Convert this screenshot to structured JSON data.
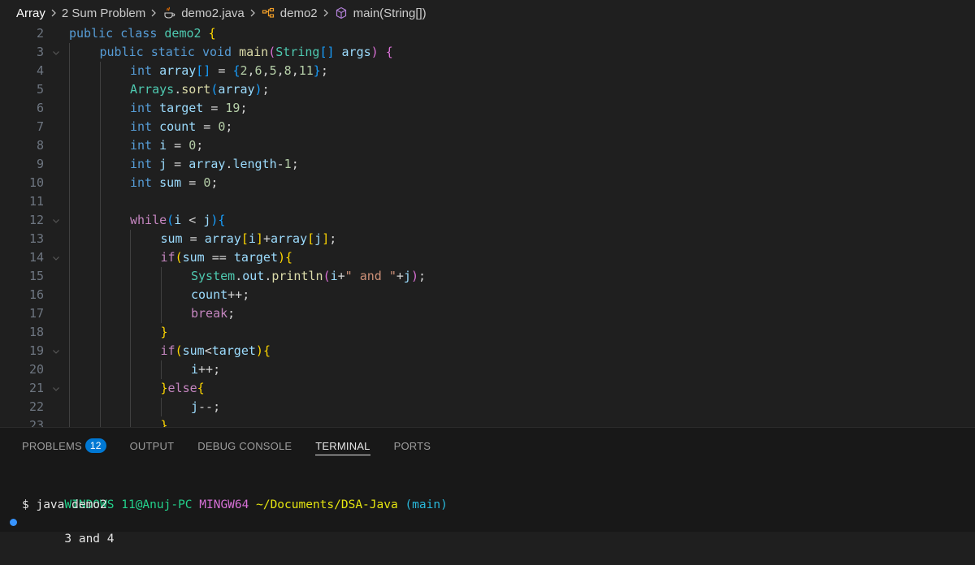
{
  "breadcrumb": {
    "items": [
      {
        "label": "Array",
        "icon": ""
      },
      {
        "label": "2 Sum Problem",
        "icon": ""
      },
      {
        "label": "demo2.java",
        "icon": "java-file-icon"
      },
      {
        "label": "demo2",
        "icon": "class-icon"
      },
      {
        "label": "main(String[])",
        "icon": "method-icon"
      }
    ]
  },
  "editor": {
    "lines": [
      {
        "num": "2",
        "fold": false,
        "indent": 0,
        "tokens": [
          [
            "kw",
            "public"
          ],
          [
            "p",
            " "
          ],
          [
            "kw",
            "class"
          ],
          [
            "p",
            " "
          ],
          [
            "type",
            "demo2"
          ],
          [
            "p",
            " "
          ],
          [
            "b1",
            "{"
          ]
        ]
      },
      {
        "num": "3",
        "fold": true,
        "indent": 1,
        "tokens": [
          [
            "kw",
            "public"
          ],
          [
            "p",
            " "
          ],
          [
            "kw",
            "static"
          ],
          [
            "p",
            " "
          ],
          [
            "kw",
            "void"
          ],
          [
            "p",
            " "
          ],
          [
            "fn",
            "main"
          ],
          [
            "b2",
            "("
          ],
          [
            "type",
            "String"
          ],
          [
            "b3",
            "[]"
          ],
          [
            "p",
            " "
          ],
          [
            "var",
            "args"
          ],
          [
            "b2",
            ")"
          ],
          [
            "p",
            " "
          ],
          [
            "b2",
            "{"
          ]
        ]
      },
      {
        "num": "4",
        "fold": false,
        "indent": 2,
        "tokens": [
          [
            "kw",
            "int"
          ],
          [
            "p",
            " "
          ],
          [
            "var",
            "array"
          ],
          [
            "b3",
            "[]"
          ],
          [
            "p",
            " = "
          ],
          [
            "b3",
            "{"
          ],
          [
            "num",
            "2"
          ],
          [
            "p",
            ","
          ],
          [
            "num",
            "6"
          ],
          [
            "p",
            ","
          ],
          [
            "num",
            "5"
          ],
          [
            "p",
            ","
          ],
          [
            "num",
            "8"
          ],
          [
            "p",
            ","
          ],
          [
            "num",
            "11"
          ],
          [
            "b3",
            "}"
          ],
          [
            "p",
            ";"
          ]
        ]
      },
      {
        "num": "5",
        "fold": false,
        "indent": 2,
        "tokens": [
          [
            "type",
            "Arrays"
          ],
          [
            "p",
            "."
          ],
          [
            "fn",
            "sort"
          ],
          [
            "b3",
            "("
          ],
          [
            "var",
            "array"
          ],
          [
            "b3",
            ")"
          ],
          [
            "p",
            ";"
          ]
        ]
      },
      {
        "num": "6",
        "fold": false,
        "indent": 2,
        "tokens": [
          [
            "kw",
            "int"
          ],
          [
            "p",
            " "
          ],
          [
            "var",
            "target"
          ],
          [
            "p",
            " = "
          ],
          [
            "num",
            "19"
          ],
          [
            "p",
            ";"
          ]
        ]
      },
      {
        "num": "7",
        "fold": false,
        "indent": 2,
        "tokens": [
          [
            "kw",
            "int"
          ],
          [
            "p",
            " "
          ],
          [
            "var",
            "count"
          ],
          [
            "p",
            " = "
          ],
          [
            "num",
            "0"
          ],
          [
            "p",
            ";"
          ]
        ]
      },
      {
        "num": "8",
        "fold": false,
        "indent": 2,
        "tokens": [
          [
            "kw",
            "int"
          ],
          [
            "p",
            " "
          ],
          [
            "var",
            "i"
          ],
          [
            "p",
            " = "
          ],
          [
            "num",
            "0"
          ],
          [
            "p",
            ";"
          ]
        ]
      },
      {
        "num": "9",
        "fold": false,
        "indent": 2,
        "tokens": [
          [
            "kw",
            "int"
          ],
          [
            "p",
            " "
          ],
          [
            "var",
            "j"
          ],
          [
            "p",
            " = "
          ],
          [
            "var",
            "array"
          ],
          [
            "p",
            "."
          ],
          [
            "var",
            "length"
          ],
          [
            "p",
            "-"
          ],
          [
            "num",
            "1"
          ],
          [
            "p",
            ";"
          ]
        ]
      },
      {
        "num": "10",
        "fold": false,
        "indent": 2,
        "tokens": [
          [
            "kw",
            "int"
          ],
          [
            "p",
            " "
          ],
          [
            "var",
            "sum"
          ],
          [
            "p",
            " = "
          ],
          [
            "num",
            "0"
          ],
          [
            "p",
            ";"
          ]
        ]
      },
      {
        "num": "11",
        "fold": false,
        "indent": 2,
        "tokens": []
      },
      {
        "num": "12",
        "fold": true,
        "indent": 2,
        "tokens": [
          [
            "ctrl",
            "while"
          ],
          [
            "b3",
            "("
          ],
          [
            "var",
            "i"
          ],
          [
            "p",
            " < "
          ],
          [
            "var",
            "j"
          ],
          [
            "b3",
            ")"
          ],
          [
            "b3",
            "{"
          ]
        ]
      },
      {
        "num": "13",
        "fold": false,
        "indent": 3,
        "tokens": [
          [
            "var",
            "sum"
          ],
          [
            "p",
            " = "
          ],
          [
            "var",
            "array"
          ],
          [
            "b1",
            "["
          ],
          [
            "var",
            "i"
          ],
          [
            "b1",
            "]"
          ],
          [
            "p",
            "+"
          ],
          [
            "var",
            "array"
          ],
          [
            "b1",
            "["
          ],
          [
            "var",
            "j"
          ],
          [
            "b1",
            "]"
          ],
          [
            "p",
            ";"
          ]
        ]
      },
      {
        "num": "14",
        "fold": true,
        "indent": 3,
        "tokens": [
          [
            "ctrl",
            "if"
          ],
          [
            "b1",
            "("
          ],
          [
            "var",
            "sum"
          ],
          [
            "p",
            " == "
          ],
          [
            "var",
            "target"
          ],
          [
            "b1",
            ")"
          ],
          [
            "b1",
            "{"
          ]
        ]
      },
      {
        "num": "15",
        "fold": false,
        "indent": 4,
        "tokens": [
          [
            "type",
            "System"
          ],
          [
            "p",
            "."
          ],
          [
            "var",
            "out"
          ],
          [
            "p",
            "."
          ],
          [
            "fn",
            "println"
          ],
          [
            "b2",
            "("
          ],
          [
            "var",
            "i"
          ],
          [
            "p",
            "+"
          ],
          [
            "str",
            "\" and \""
          ],
          [
            "p",
            "+"
          ],
          [
            "var",
            "j"
          ],
          [
            "b2",
            ")"
          ],
          [
            "p",
            ";"
          ]
        ]
      },
      {
        "num": "16",
        "fold": false,
        "indent": 4,
        "tokens": [
          [
            "var",
            "count"
          ],
          [
            "p",
            "++;"
          ]
        ]
      },
      {
        "num": "17",
        "fold": false,
        "indent": 4,
        "tokens": [
          [
            "ctrl",
            "break"
          ],
          [
            "p",
            ";"
          ]
        ]
      },
      {
        "num": "18",
        "fold": false,
        "indent": 3,
        "tokens": [
          [
            "b1",
            "}"
          ]
        ]
      },
      {
        "num": "19",
        "fold": true,
        "indent": 3,
        "tokens": [
          [
            "ctrl",
            "if"
          ],
          [
            "b1",
            "("
          ],
          [
            "var",
            "sum"
          ],
          [
            "p",
            "<"
          ],
          [
            "var",
            "target"
          ],
          [
            "b1",
            ")"
          ],
          [
            "b1",
            "{"
          ]
        ]
      },
      {
        "num": "20",
        "fold": false,
        "indent": 4,
        "tokens": [
          [
            "var",
            "i"
          ],
          [
            "p",
            "++;"
          ]
        ]
      },
      {
        "num": "21",
        "fold": true,
        "indent": 3,
        "tokens": [
          [
            "b1",
            "}"
          ],
          [
            "ctrl",
            "else"
          ],
          [
            "b1",
            "{"
          ]
        ]
      },
      {
        "num": "22",
        "fold": false,
        "indent": 4,
        "tokens": [
          [
            "var",
            "j"
          ],
          [
            "p",
            "--;"
          ]
        ]
      },
      {
        "num": "23",
        "fold": false,
        "indent": 3,
        "tokens": [
          [
            "b1",
            "}"
          ]
        ]
      }
    ]
  },
  "panel": {
    "tabs": [
      {
        "label": "PROBLEMS",
        "badge": "12",
        "active": false
      },
      {
        "label": "OUTPUT",
        "badge": "",
        "active": false
      },
      {
        "label": "DEBUG CONSOLE",
        "badge": "",
        "active": false
      },
      {
        "label": "TERMINAL",
        "badge": "",
        "active": true
      },
      {
        "label": "PORTS",
        "badge": "",
        "active": false
      }
    ],
    "terminal": {
      "prompt_user": "WINDOWS 11@Anuj-PC",
      "prompt_env": "MINGW64",
      "prompt_path": "~/Documents/DSA-Java",
      "prompt_branch": "(main)",
      "command": "$ java demo2",
      "output": "3 and 4"
    }
  },
  "colors": {
    "accent": "#0078d4",
    "background": "#1f1f1f",
    "panel_background": "#181818"
  }
}
